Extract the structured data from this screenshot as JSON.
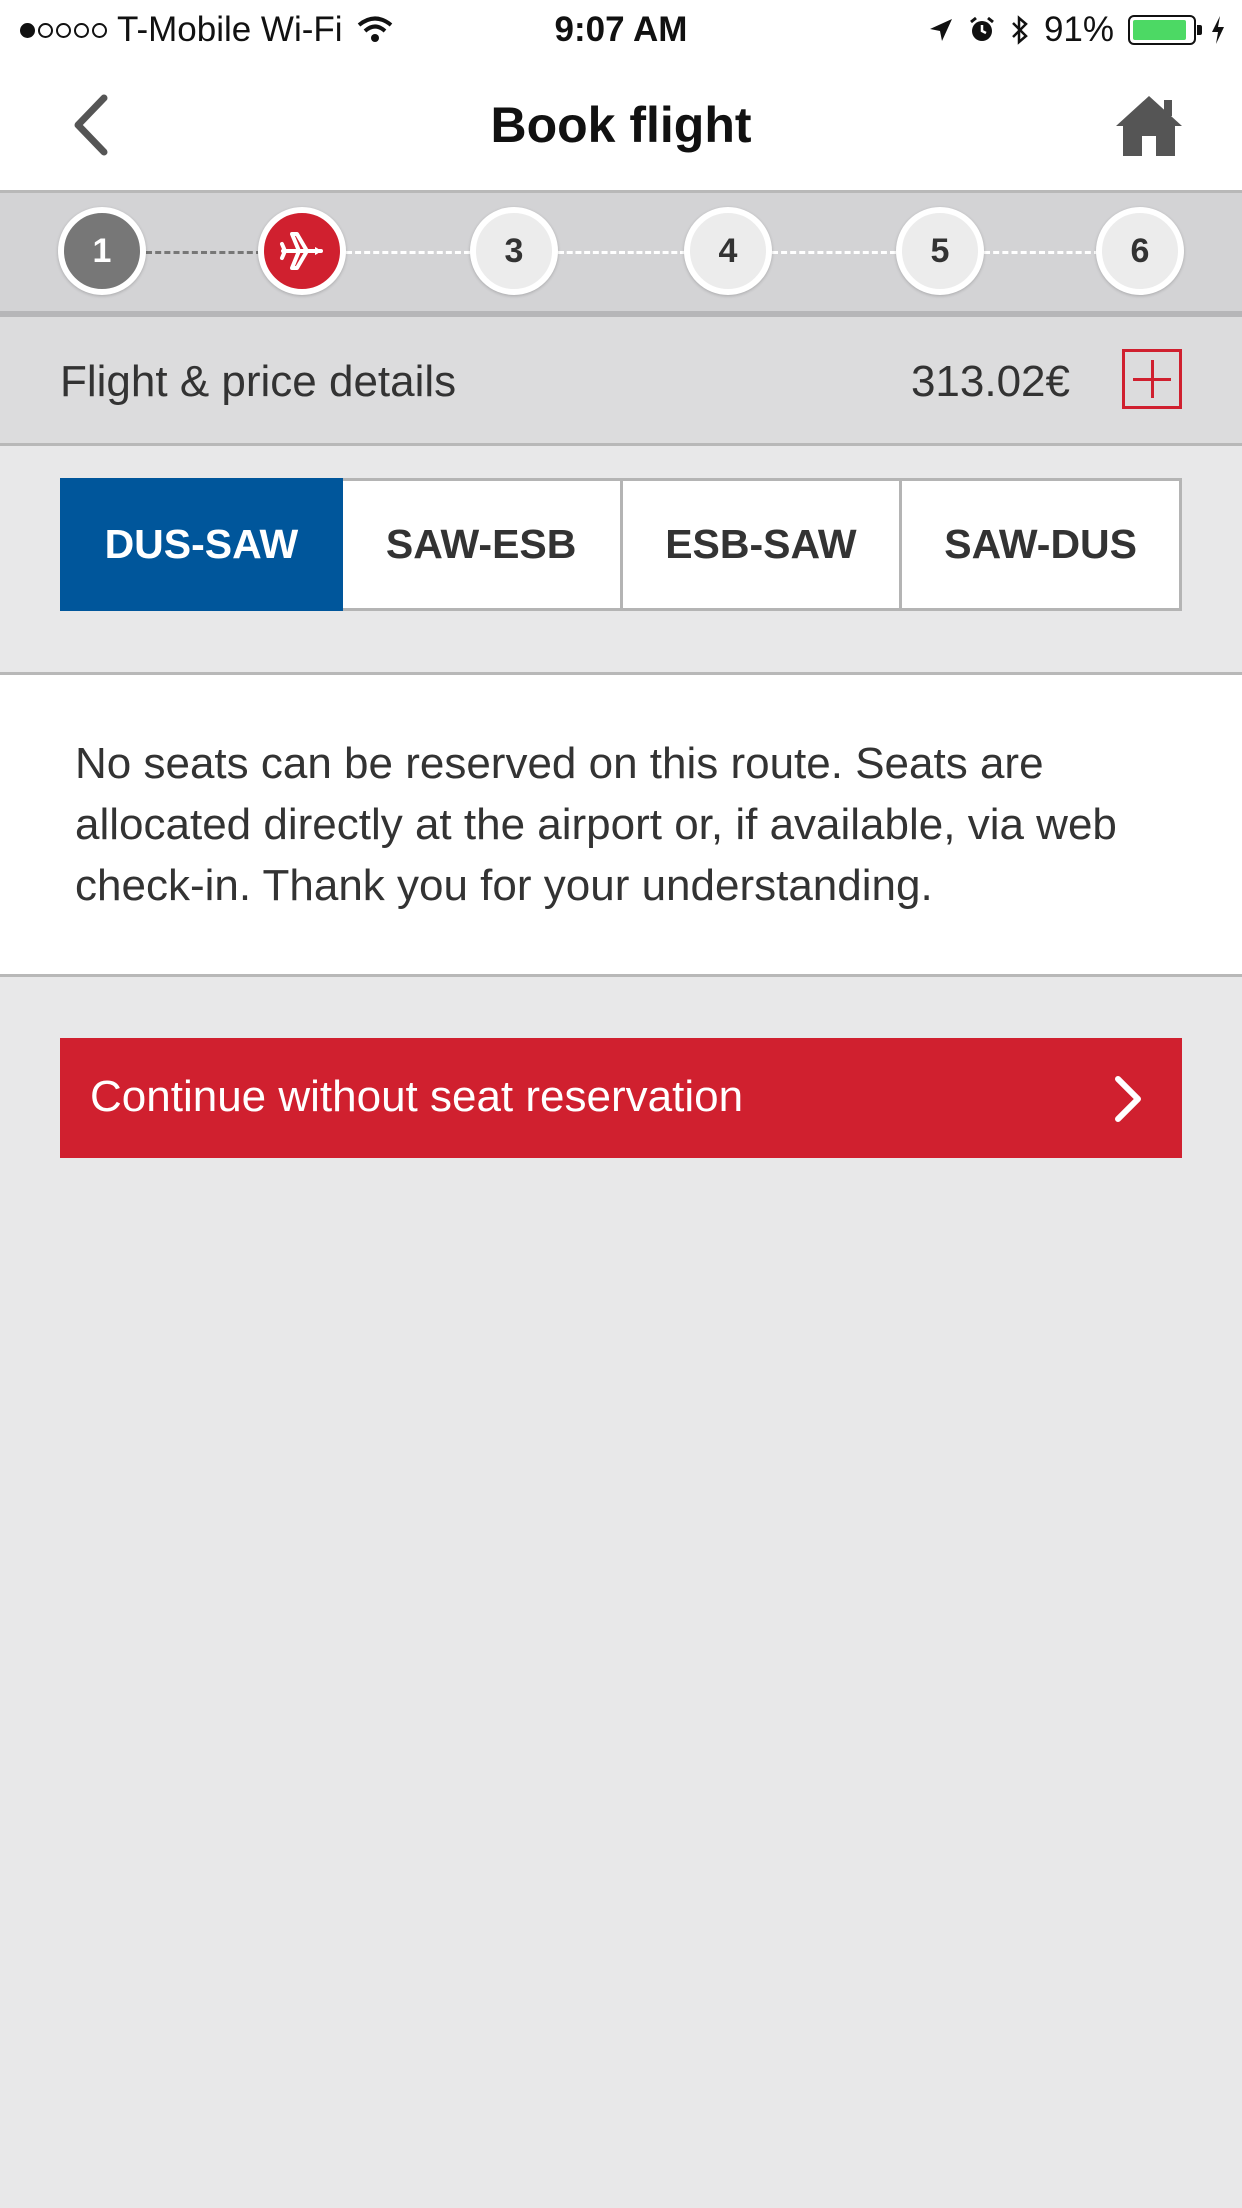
{
  "status_bar": {
    "carrier": "T-Mobile Wi-Fi",
    "time": "9:07 AM",
    "battery": "91%",
    "battery_level": 0.91,
    "signal_bars": 1,
    "signal_total": 5
  },
  "nav": {
    "title": "Book flight",
    "back_icon": "chevron-left-icon",
    "home_icon": "home-icon"
  },
  "steps": {
    "items": [
      "1",
      "",
      "3",
      "4",
      "5",
      "6"
    ],
    "active_index": 1,
    "active_icon": "airplane-icon"
  },
  "price": {
    "label": "Flight & price details",
    "amount": "313.02€",
    "expand_icon": "plus-icon"
  },
  "segments": {
    "items": [
      "DUS-SAW",
      "SAW-ESB",
      "ESB-SAW",
      "SAW-DUS"
    ],
    "selected_index": 0
  },
  "message": {
    "text": "No seats can be reserved on this route. Seats are allocated directly at the airport or, if available, via web check-in. Thank you for your understanding."
  },
  "continue": {
    "label": "Continue without seat reservation",
    "icon": "chevron-right-icon"
  },
  "colors": {
    "accent_red": "#d0202f",
    "selected_blue": "#00569b",
    "background": "#e8e8e9"
  }
}
